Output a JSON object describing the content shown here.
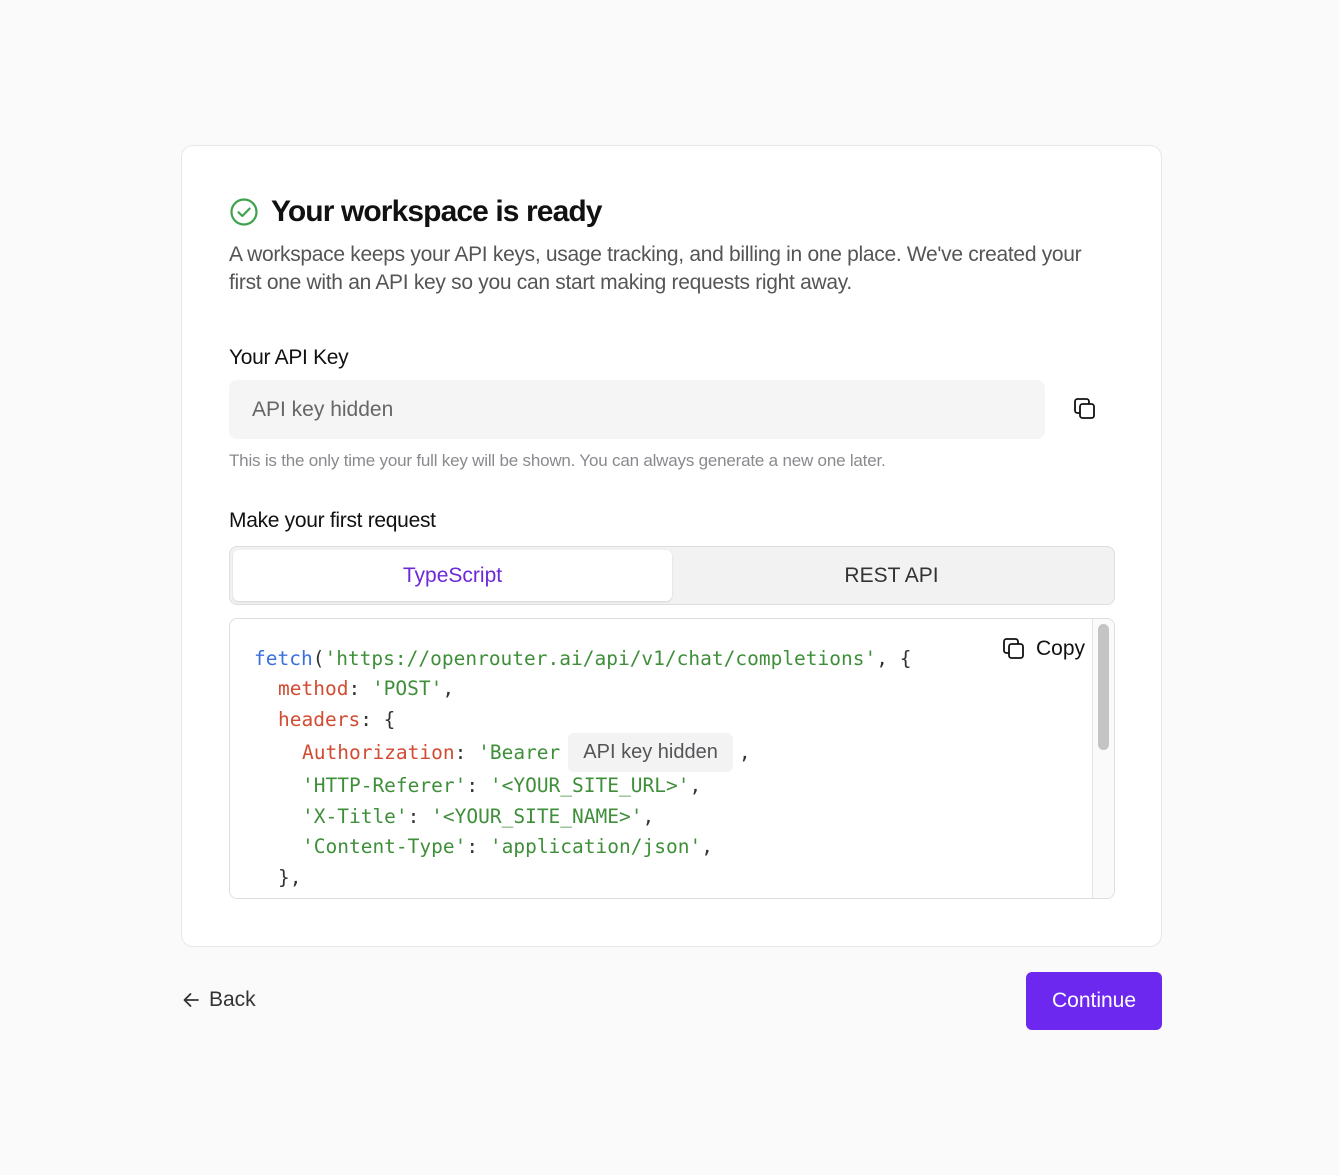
{
  "header": {
    "title": "Your workspace is ready",
    "description": "A workspace keeps your API keys, usage tracking, and billing in one place. We've created your first one with an API key so you can start making requests right away."
  },
  "api_key": {
    "label": "Your API Key",
    "value": "API key hidden",
    "hint": "This is the only time your full key will be shown. You can always generate a new one later."
  },
  "request": {
    "label": "Make your first request",
    "tabs": [
      {
        "label": "TypeScript",
        "active": true
      },
      {
        "label": "REST API",
        "active": false
      }
    ],
    "copy_label": "Copy",
    "code": {
      "l1_fn": "fetch",
      "l1_open": "(",
      "l1_url": "'https://openrouter.ai/api/v1/chat/completions'",
      "l1_end": ", {",
      "l2_key": "method",
      "l2_colon": ": ",
      "l2_val": "'POST'",
      "l2_end": ",",
      "l3_key": "headers",
      "l3_end": ": {",
      "l4_key": "Authorization",
      "l4_colon": ": ",
      "l4_val": "'Bearer",
      "l4_chip": "API key hidden",
      "l4_end": ",",
      "l5_key": "'HTTP-Referer'",
      "l5_colon": ": ",
      "l5_val": "'<YOUR_SITE_URL>'",
      "l5_end": ",",
      "l6_key": "'X-Title'",
      "l6_colon": ": ",
      "l6_val": "'<YOUR_SITE_NAME>'",
      "l6_end": ",",
      "l7_key": "'Content-Type'",
      "l7_colon": ": ",
      "l7_val": "'application/json'",
      "l7_end": ",",
      "l8": "},"
    }
  },
  "footer": {
    "back_label": "Back",
    "continue_label": "Continue"
  },
  "colors": {
    "accent": "#6d28f0",
    "active_tab_text": "#6d28d9",
    "success": "#3fa34d",
    "code_function": "#3b6fe0",
    "code_string": "#3f8f3a",
    "code_property": "#d24b32"
  },
  "icons": {
    "status": "check-circle-icon",
    "copy": "copy-icon",
    "back": "arrow-left-icon"
  }
}
